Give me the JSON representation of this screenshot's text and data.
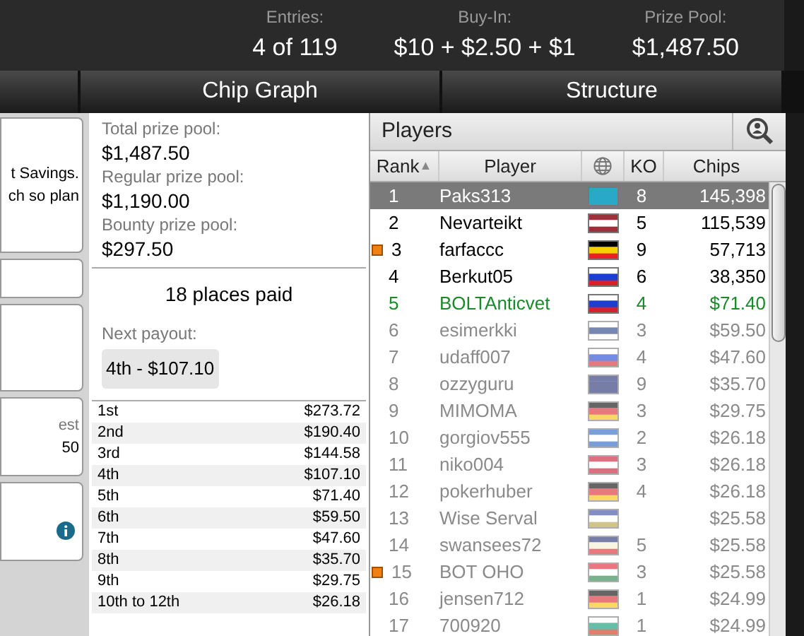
{
  "header": {
    "stats": [
      {
        "label": "Entries:",
        "value": "4 of 119"
      },
      {
        "label": "Buy-In:",
        "value": "$10 + $2.50 + $1"
      },
      {
        "label": "Prize Pool:",
        "value": "$1,487.50"
      }
    ]
  },
  "tabs": [
    {
      "selected": false
    },
    {
      "label": "Chip Graph",
      "selected": false
    },
    {
      "label": "Structure",
      "selected": false
    }
  ],
  "side_cards": [
    {
      "lines": [
        "t Savings.",
        "ch so plan"
      ],
      "info": false
    },
    {
      "info": false
    },
    {
      "info": false
    },
    {
      "lines": [
        "est",
        "50"
      ],
      "info": false
    },
    {
      "info": true
    }
  ],
  "prizes": {
    "items": [
      {
        "label": "Total prize pool:",
        "value": "$1,487.50"
      },
      {
        "label": "Regular prize pool:",
        "value": "$1,190.00"
      },
      {
        "label": "Bounty prize pool:",
        "value": "$297.50"
      }
    ],
    "places_paid": "18 places paid",
    "next_payout_label": "Next payout:",
    "next_payout": "4th - $107.10",
    "payouts": [
      [
        "1st",
        "$273.72"
      ],
      [
        "2nd",
        "$190.40"
      ],
      [
        "3rd",
        "$144.58"
      ],
      [
        "4th",
        "$107.10"
      ],
      [
        "5th",
        "$71.40"
      ],
      [
        "6th",
        "$59.50"
      ],
      [
        "7th",
        "$47.60"
      ],
      [
        "8th",
        "$35.70"
      ],
      [
        "9th",
        "$29.75"
      ],
      [
        "10th to 12th",
        "$26.18"
      ]
    ]
  },
  "players": {
    "title": "Players",
    "columns": [
      "Rank",
      "Player",
      "KO",
      "Chips"
    ],
    "sort_indicator": "▲",
    "rows": [
      {
        "rank": "1",
        "name": "Paks313",
        "ko": "8",
        "chips": "145,398",
        "kind": "active",
        "selected": true,
        "marked": false
      },
      {
        "rank": "2",
        "name": "Nevarteikt",
        "ko": "5",
        "chips": "115,539",
        "kind": "active",
        "selected": false,
        "marked": false
      },
      {
        "rank": "3",
        "name": "farfaccc",
        "ko": "9",
        "chips": "57,713",
        "kind": "active",
        "selected": false,
        "marked": true
      },
      {
        "rank": "4",
        "name": "Berkut05",
        "ko": "6",
        "chips": "38,350",
        "kind": "active",
        "selected": false,
        "marked": false
      },
      {
        "rank": "5",
        "name": "BOLTAnticvet",
        "ko": "4",
        "chips": "$71.40",
        "kind": "paid",
        "selected": false,
        "marked": false
      },
      {
        "rank": "6",
        "name": "esimerkki",
        "ko": "3",
        "chips": "$59.50",
        "kind": "out",
        "selected": false,
        "marked": false
      },
      {
        "rank": "7",
        "name": "udaff007",
        "ko": "4",
        "chips": "$47.60",
        "kind": "out",
        "selected": false,
        "marked": false
      },
      {
        "rank": "8",
        "name": "ozzyguru",
        "ko": "9",
        "chips": "$35.70",
        "kind": "out",
        "selected": false,
        "marked": false
      },
      {
        "rank": "9",
        "name": "MIMOMA",
        "ko": "3",
        "chips": "$29.75",
        "kind": "out",
        "selected": false,
        "marked": false
      },
      {
        "rank": "10",
        "name": "gorgiov555",
        "ko": "2",
        "chips": "$26.18",
        "kind": "out",
        "selected": false,
        "marked": false
      },
      {
        "rank": "11",
        "name": "niko004",
        "ko": "3",
        "chips": "$26.18",
        "kind": "out",
        "selected": false,
        "marked": false
      },
      {
        "rank": "12",
        "name": "pokerhuber",
        "ko": "4",
        "chips": "$26.18",
        "kind": "out",
        "selected": false,
        "marked": false
      },
      {
        "rank": "13",
        "name": "Wise Serval",
        "chips": "$25.58",
        "kind": "out",
        "selected": false,
        "marked": false
      },
      {
        "rank": "14",
        "name": "swansees72",
        "ko": "5",
        "chips": "$25.58",
        "kind": "out",
        "selected": false,
        "marked": false
      },
      {
        "rank": "15",
        "name": "BOT OHO",
        "ko": "3",
        "chips": "$25.58",
        "kind": "out",
        "selected": false,
        "marked": true
      },
      {
        "rank": "16",
        "name": "jensen712",
        "ko": "1",
        "chips": "$24.99",
        "kind": "out",
        "selected": false,
        "marked": false
      },
      {
        "rank": "17",
        "name": "700920",
        "ko": "1",
        "chips": "$24.99",
        "kind": "out",
        "selected": false,
        "marked": false
      }
    ]
  }
}
